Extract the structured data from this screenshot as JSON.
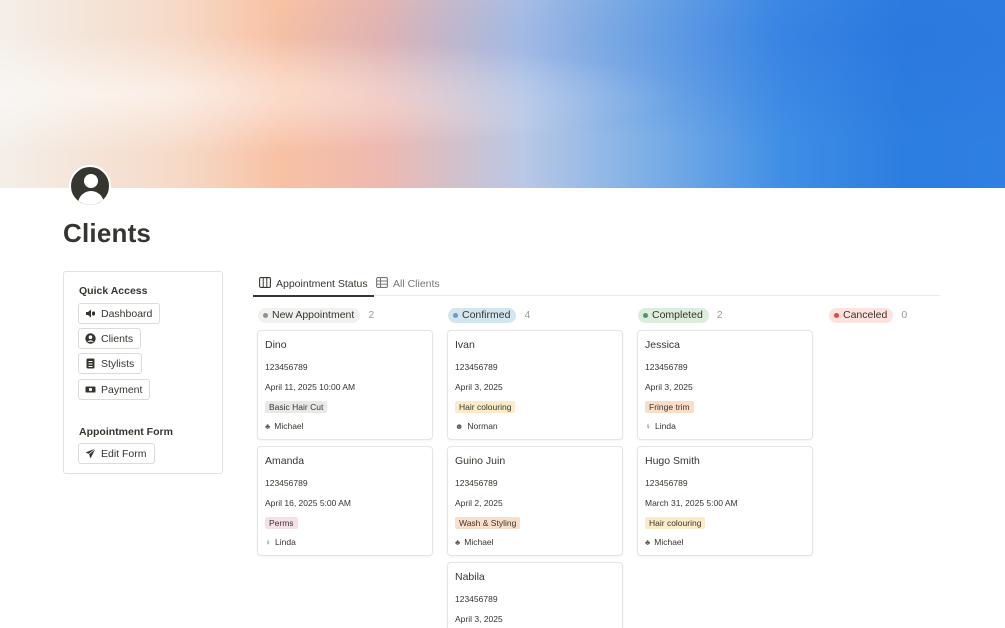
{
  "page": {
    "title": "Clients"
  },
  "sidebar": {
    "quick_access_heading": "Quick Access",
    "items": [
      {
        "label": "Dashboard",
        "icon": "megaphone-icon"
      },
      {
        "label": "Clients",
        "icon": "user-circle-icon"
      },
      {
        "label": "Stylists",
        "icon": "id-badge-icon"
      },
      {
        "label": "Payment",
        "icon": "money-icon"
      }
    ],
    "form_heading": "Appointment Form",
    "form_button": {
      "label": "Edit Form",
      "icon": "paper-plane-icon"
    }
  },
  "tabs": [
    {
      "label": "Appointment Status",
      "icon": "board-icon",
      "active": true
    },
    {
      "label": "All Clients",
      "icon": "table-icon",
      "active": false
    }
  ],
  "columns": [
    {
      "label": "New Appointment",
      "count": "2",
      "color": "#91918e",
      "bg": "#f1f1ef"
    },
    {
      "label": "Confirmed",
      "count": "4",
      "color": "#5e9fd6",
      "bg": "#d3e5ef"
    },
    {
      "label": "Completed",
      "count": "2",
      "color": "#4f9768",
      "bg": "#dbeddb"
    },
    {
      "label": "Canceled",
      "count": "0",
      "color": "#d44c47",
      "bg": "#ffe2dd"
    }
  ],
  "cards": [
    [
      {
        "name": "Dino",
        "phone": "123456789",
        "date": "April 11, 2025 10:00 AM",
        "service": "Basic Hair Cut",
        "service_bg": "#e9e9e7",
        "stylist": "Michael"
      },
      {
        "name": "Amanda",
        "phone": "123456789",
        "date": "April 16, 2025 5:00 AM",
        "service": "Perms",
        "service_bg": "#f5e0e9",
        "stylist": "Linda"
      }
    ],
    [
      {
        "name": "Ivan",
        "phone": "123456789",
        "date": "April 3, 2025",
        "service": "Hair colouring",
        "service_bg": "#fbecc8",
        "stylist": "Norman"
      },
      {
        "name": "Guino Juin",
        "phone": "123456789",
        "date": "April 2, 2025",
        "service": "Wash & Styling",
        "service_bg": "#fadec9",
        "stylist": "Michael"
      },
      {
        "name": "Nabila",
        "phone": "123456789",
        "date": "April 3, 2025"
      }
    ],
    [
      {
        "name": "Jessica",
        "phone": "123456789",
        "date": "April 3, 2025",
        "service": "Fringe trim",
        "service_bg": "#fadec9",
        "stylist": "Linda"
      },
      {
        "name": "Hugo Smith",
        "phone": "123456789",
        "date": "March 31, 2025 5:00 AM",
        "service": "Hair colouring",
        "service_bg": "#fbecc8",
        "stylist": "Michael"
      }
    ],
    []
  ]
}
